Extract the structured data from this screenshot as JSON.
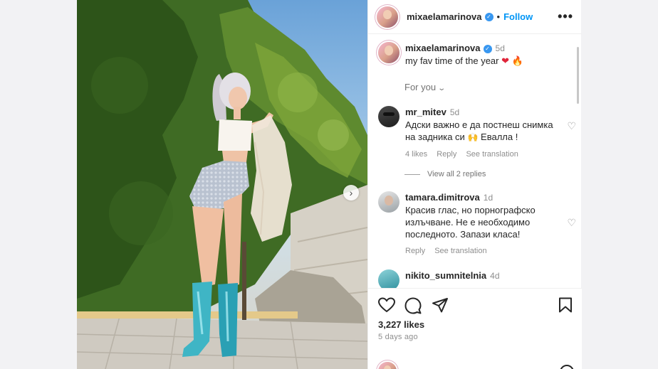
{
  "header": {
    "username": "mixaelamarinova",
    "separator": "•",
    "follow_label": "Follow",
    "more_label": "•••"
  },
  "caption": {
    "username": "mixaelamarinova",
    "time": "5d",
    "text": "my fav time of the year"
  },
  "for_you": {
    "label": "For you",
    "chevron": "⌄"
  },
  "comments": [
    {
      "username": "mr_mitev",
      "time": "5d",
      "text": "Адски важно е да постнеш снимка на задника си",
      "emoji": "🙌",
      "text_tail": "Евалла !",
      "likes": "4 likes",
      "reply": "Reply",
      "translate": "See translation"
    },
    {
      "username": "tamara.dimitrova",
      "time": "1d",
      "text": "Красив глас, но порнографско излъчване. Не е необходимо последното. Запази класа!",
      "reply": "Reply",
      "translate": "See translation"
    },
    {
      "username": "nikito_sumnitelnia",
      "time": "4d"
    }
  ],
  "view_replies": {
    "label": "View all 2 replies"
  },
  "actions": {
    "likes": "3,227 likes",
    "ago": "5 days ago"
  },
  "colors": {
    "accent": "#0095f6",
    "verified": "#3897f0",
    "muted": "#8e8e8e",
    "heart": "#e0253a"
  },
  "icons": {
    "heart": "heart-icon",
    "comment": "comment-icon",
    "share": "share-icon",
    "save": "bookmark-icon",
    "next": "chevron-right-icon"
  }
}
